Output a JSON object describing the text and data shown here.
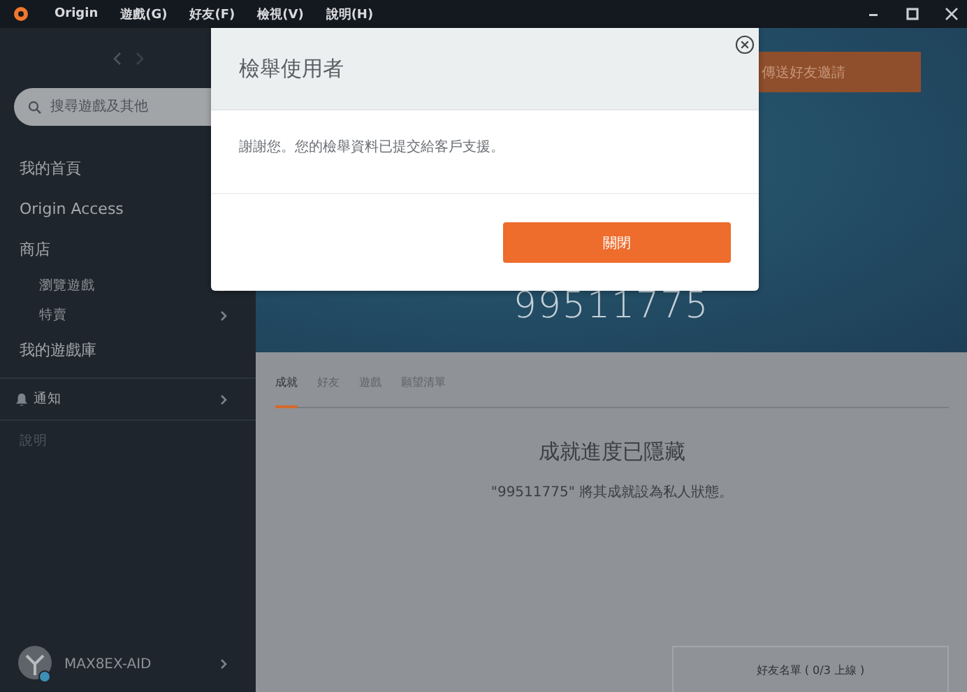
{
  "menu_bar": {
    "items": [
      "Origin",
      "遊戲(G)",
      "好友(F)",
      "檢視(V)",
      "說明(H)"
    ]
  },
  "sidebar": {
    "search": {
      "placeholder": "搜尋遊戲及其他"
    },
    "items": [
      {
        "label": "我的首頁",
        "kind": "main"
      },
      {
        "label": "Origin Access",
        "kind": "main"
      },
      {
        "label": "商店",
        "kind": "main",
        "children": [
          {
            "label": "瀏覽遊戲"
          },
          {
            "label": "特賣"
          }
        ]
      },
      {
        "label": "我的遊戲庫",
        "kind": "main"
      },
      {
        "label": "通知",
        "kind": "notify"
      },
      {
        "label": "說明",
        "kind": "muted"
      }
    ],
    "user": {
      "name": "MAX8EX-AID"
    }
  },
  "profile": {
    "username": "99511775",
    "invite_button": "傳送好友邀請",
    "tabs": [
      {
        "label": "成就",
        "selected": true
      },
      {
        "label": "好友",
        "selected": false
      },
      {
        "label": "遊戲",
        "selected": false
      },
      {
        "label": "願望清單",
        "selected": false
      }
    ],
    "heading": "成就進度已隱藏",
    "message": "\"99511775\" 將其成就設為私人狀態。",
    "friends_panel": "好友名單 ( 0/3 上線 )"
  },
  "dialog": {
    "title": "檢舉使用者",
    "message": "謝謝您。您的檢舉資料已提交給客戶支援。",
    "button": "關閉"
  }
}
